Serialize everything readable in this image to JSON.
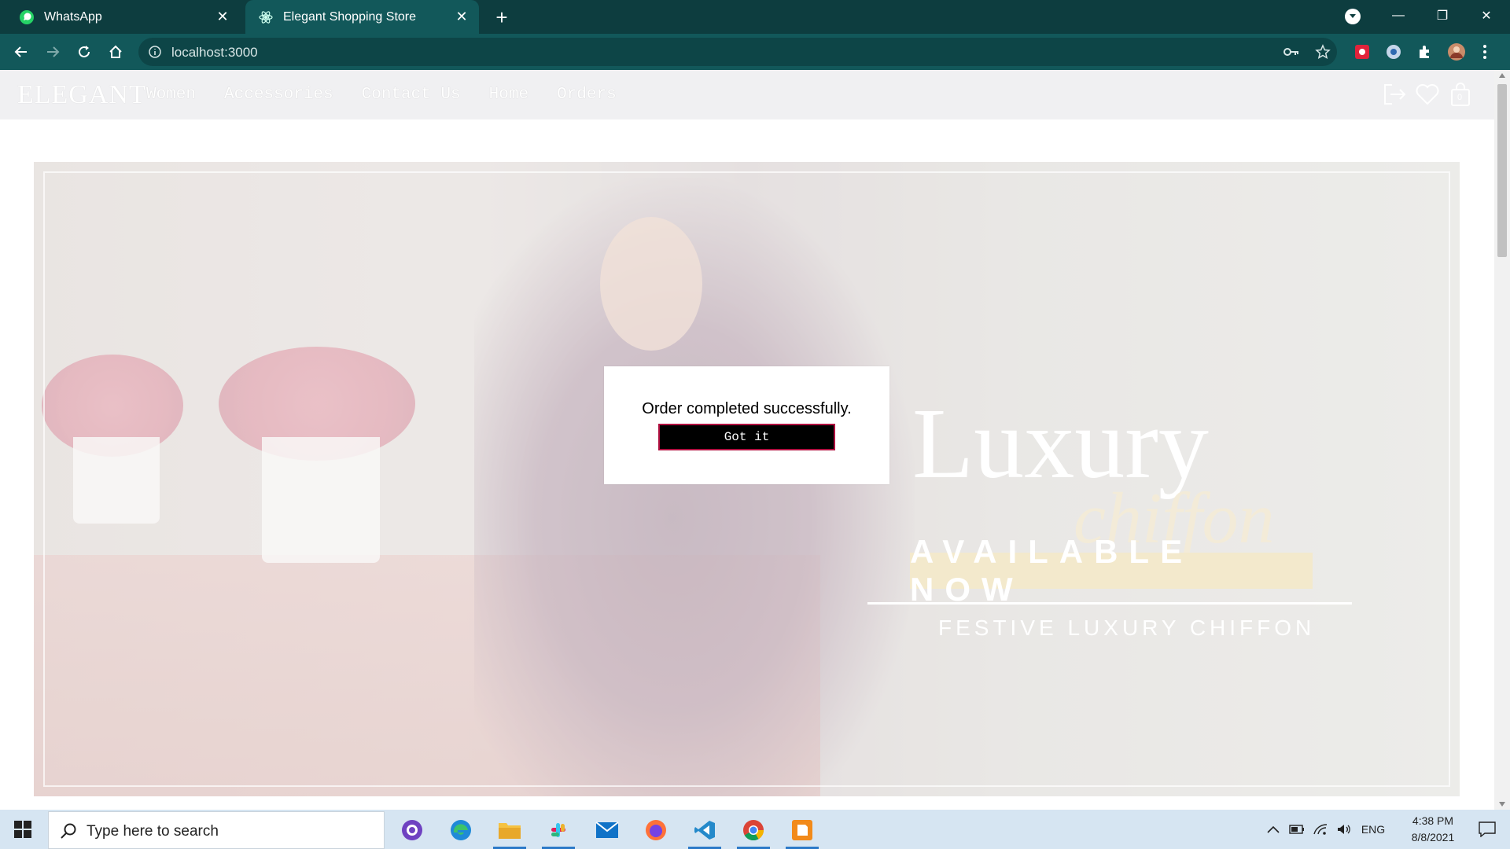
{
  "browser": {
    "tabs": [
      {
        "title": "WhatsApp",
        "active": false
      },
      {
        "title": "Elegant Shopping Store",
        "active": true
      }
    ],
    "url": "localhost:3000"
  },
  "site": {
    "logo": "ELEGANT",
    "nav": [
      "Women",
      "Accessories",
      "Contact Us",
      "Home",
      "Orders"
    ],
    "cart_count": "0"
  },
  "hero": {
    "title": "Luxury",
    "script": "chiffon",
    "banner": "AVAILABLE NOW",
    "subtitle": "FESTIVE LUXURY CHIFFON"
  },
  "modal": {
    "message": "Order completed successfully.",
    "button": "Got it"
  },
  "taskbar": {
    "search_placeholder": "Type here to search",
    "language": "ENG",
    "time": "4:38 PM",
    "date": "8/8/2021"
  },
  "colors": {
    "chrome_dark": "#0d3d3f",
    "chrome_active": "#12585a",
    "modal_button_bg": "#000000",
    "modal_button_border": "#b01040"
  }
}
